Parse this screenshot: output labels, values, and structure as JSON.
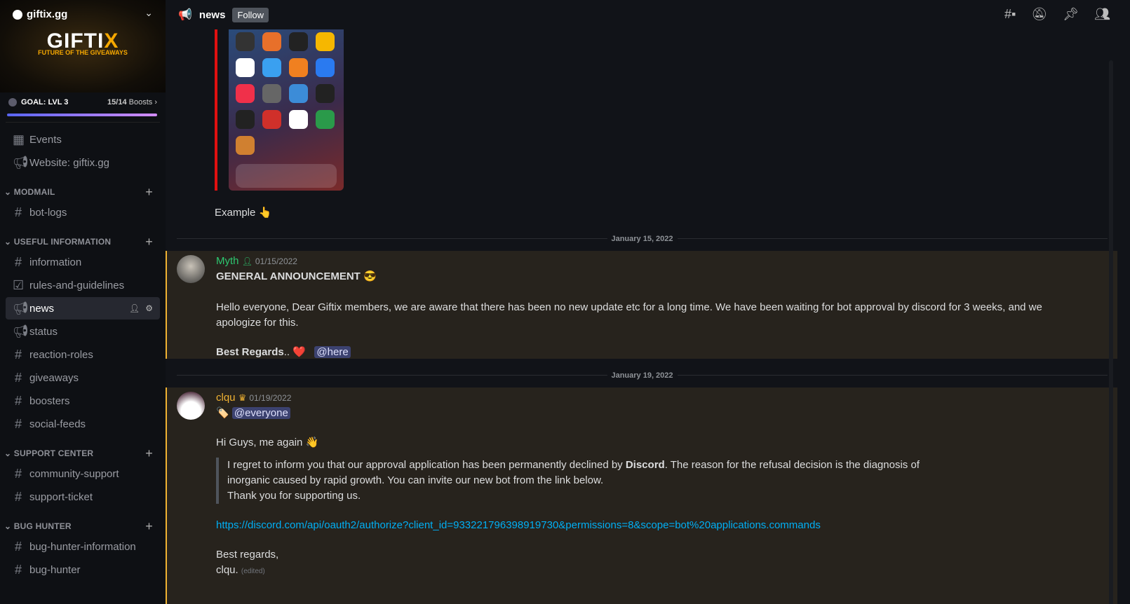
{
  "server": {
    "name": "giftix.gg",
    "banner_logo": "GIFTIX",
    "banner_tagline": "FUTURE OF THE GIVEAWAYS",
    "goal": "GOAL: LVL 3",
    "boosts_count": "15/14",
    "boosts_label": "Boosts",
    "boost_progress": 1.0
  },
  "sidebar": {
    "top": [
      {
        "icon": "calendar-icon",
        "label": "Events"
      },
      {
        "icon": "megaphone-icon",
        "label": "Website: giftix.gg"
      }
    ],
    "categories": [
      {
        "name": "MODMAIL",
        "channels": [
          {
            "icon": "#",
            "label": "bot-logs"
          }
        ]
      },
      {
        "name": "USEFUL INFORMATION",
        "channels": [
          {
            "icon": "#",
            "label": "information"
          },
          {
            "icon": "☑",
            "label": "rules-and-guidelines"
          },
          {
            "icon": "📢",
            "label": "news",
            "active": true
          },
          {
            "icon": "📢",
            "label": "status"
          },
          {
            "icon": "#",
            "label": "reaction-roles"
          },
          {
            "icon": "#",
            "label": "giveaways"
          },
          {
            "icon": "#",
            "label": "boosters"
          },
          {
            "icon": "#",
            "label": "social-feeds"
          }
        ]
      },
      {
        "name": "SUPPORT CENTER",
        "channels": [
          {
            "icon": "#",
            "label": "community-support"
          },
          {
            "icon": "#",
            "label": "support-ticket"
          }
        ]
      },
      {
        "name": "BUG HUNTER",
        "channels": [
          {
            "icon": "#",
            "label": "bug-hunter-information"
          },
          {
            "icon": "#",
            "label": "bug-hunter"
          }
        ]
      }
    ]
  },
  "header": {
    "channel": "news",
    "follow": "Follow",
    "icons": [
      "threads-icon",
      "mute-icon",
      "pin-icon",
      "members-icon"
    ]
  },
  "messages": {
    "prev_caption": "Example 👆",
    "date1": "January 15, 2022",
    "m1": {
      "author": "Myth",
      "author_color": "#2dc770",
      "time": "01/15/2022",
      "title": "GENERAL ANNOUNCEMENT 😎",
      "body": "Hello everyone, Dear Giftix members, we are aware that there has been no new update etc for a long time. We have been waiting for bot approval by discord for 3 weeks, and we apologize for this.",
      "sign": "Best Regards",
      "sign_rest": ".. ❤️",
      "mention": "@here"
    },
    "date2": "January 19, 2022",
    "m2": {
      "author": "clqu",
      "author_color": "#f0b232",
      "time": "01/19/2022",
      "tag_emoji": "🏷️",
      "mention": "@everyone",
      "greeting": "Hi Guys, me again 👋",
      "quote_a": "I regret to inform you that our approval application has been permanently declined by ",
      "quote_bold": "Discord",
      "quote_b": ". The reason for the refusal decision is the diagnosis of inorganic caused by rapid growth. You can invite our new bot from the link below.",
      "quote_c": "Thank you for supporting us.",
      "link": "https://discord.com/api/oauth2/authorize?client_id=933221796398919730&permissions=8&scope=bot%20applications.commands",
      "regards": "Best regards,",
      "signoff": "clqu.",
      "edited": "(edited)"
    }
  }
}
